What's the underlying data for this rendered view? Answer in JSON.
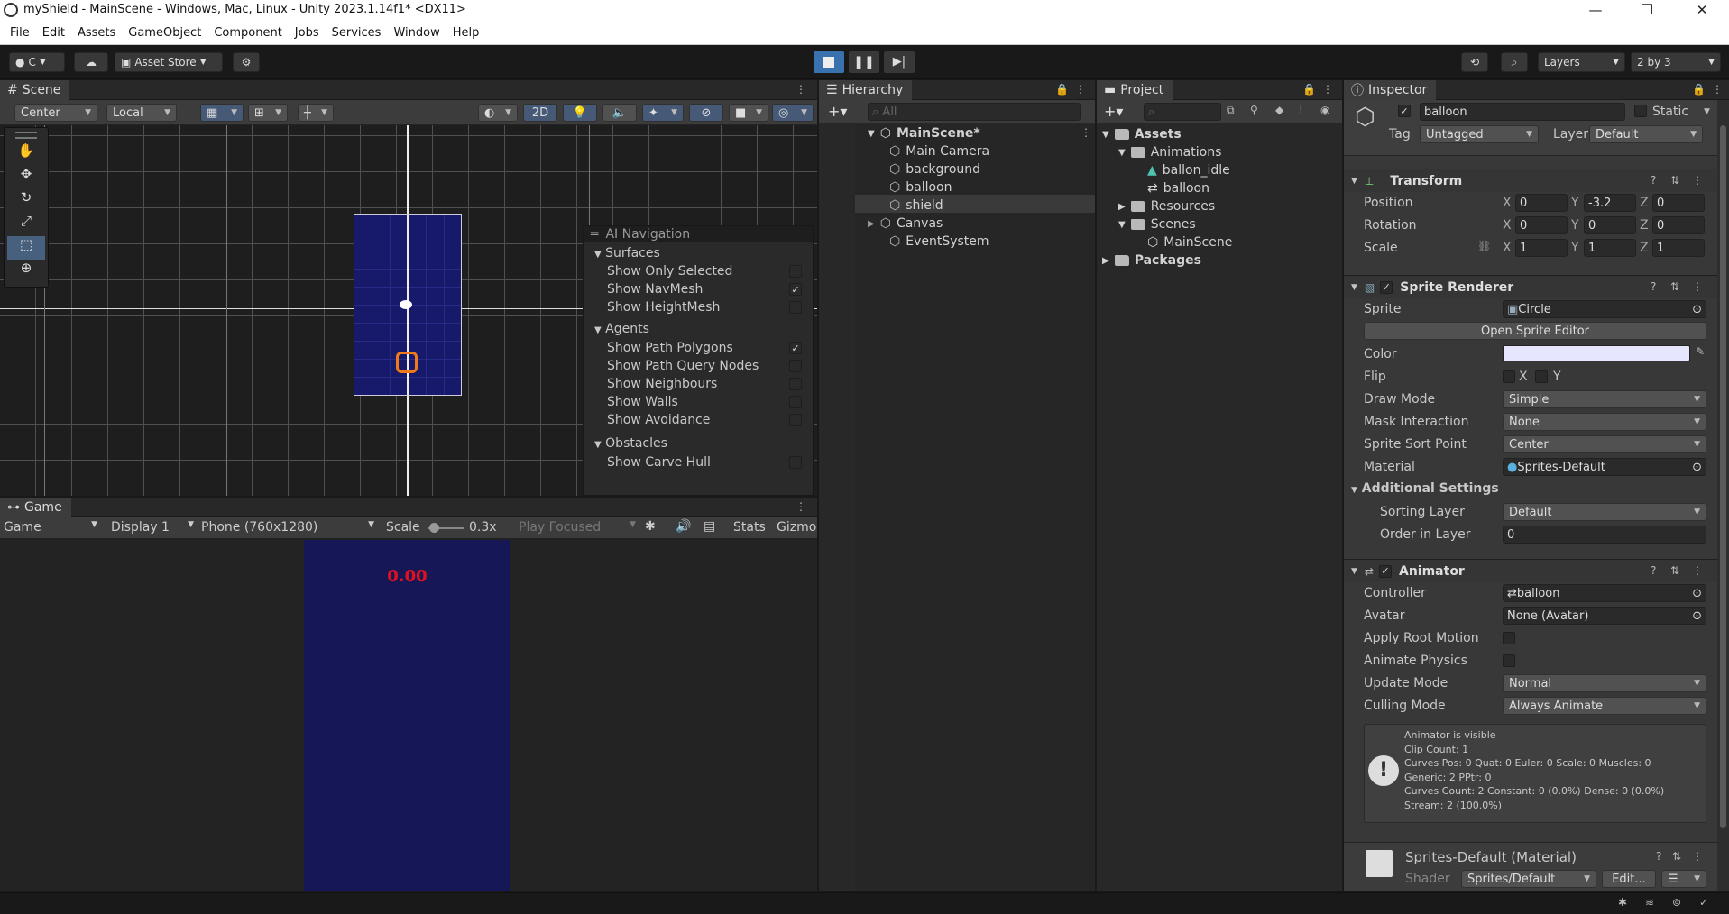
{
  "window": {
    "title": "myShield - MainScene - Windows, Mac, Linux - Unity 2023.1.14f1* <DX11>",
    "min": "—",
    "max": "❐",
    "close": "✕"
  },
  "menu": [
    "File",
    "Edit",
    "Assets",
    "GameObject",
    "Component",
    "Jobs",
    "Services",
    "Window",
    "Help"
  ],
  "toolbar": {
    "account": "C",
    "asset_store": "Asset Store",
    "layers": "Layers",
    "layout": "2 by 3"
  },
  "scene": {
    "tab": "Scene",
    "pivot": "Center",
    "space": "Local",
    "mode2d": "2D"
  },
  "ai_nav": {
    "title": "AI Navigation",
    "sections": [
      {
        "name": "Surfaces",
        "items": [
          {
            "label": "Show Only Selected",
            "checked": false
          },
          {
            "label": "Show NavMesh",
            "checked": true
          },
          {
            "label": "Show HeightMesh",
            "checked": false
          }
        ]
      },
      {
        "name": "Agents",
        "items": [
          {
            "label": "Show Path Polygons",
            "checked": true
          },
          {
            "label": "Show Path Query Nodes",
            "checked": false
          },
          {
            "label": "Show Neighbours",
            "checked": false
          },
          {
            "label": "Show Walls",
            "checked": false
          },
          {
            "label": "Show Avoidance",
            "checked": false
          }
        ]
      },
      {
        "name": "Obstacles",
        "items": [
          {
            "label": "Show Carve Hull",
            "checked": false
          }
        ]
      }
    ]
  },
  "game": {
    "tab": "Game",
    "view": "Game",
    "display": "Display 1",
    "resolution": "Phone (760x1280)",
    "scale_label": "Scale",
    "scale_value": "0.3x",
    "play_focused": "Play Focused",
    "stats": "Stats",
    "gizmos": "Gizmo",
    "score": "0.00"
  },
  "hierarchy": {
    "tab": "Hierarchy",
    "search": "All",
    "scene": "MainScene*",
    "items": [
      "Main Camera",
      "background",
      "balloon",
      "shield",
      "Canvas",
      "EventSystem"
    ]
  },
  "project": {
    "tab": "Project",
    "assets": "Assets",
    "animations": "Animations",
    "anim_items": [
      "ballon_idle",
      "balloon"
    ],
    "resources": "Resources",
    "scenes": "Scenes",
    "scene_item": "MainScene",
    "packages": "Packages"
  },
  "inspector": {
    "tab": "Inspector",
    "name": "balloon",
    "static": "Static",
    "tag_label": "Tag",
    "tag": "Untagged",
    "layer_label": "Layer",
    "layer": "Default",
    "transform": {
      "title": "Transform",
      "position": "Position",
      "rotation": "Rotation",
      "scale": "Scale",
      "px": "0",
      "py": "-3.2",
      "pz": "0",
      "rx": "0",
      "ry": "0",
      "rz": "0",
      "sx": "1",
      "sy": "1",
      "sz": "1",
      "x": "X",
      "y": "Y",
      "z": "Z"
    },
    "sprite_renderer": {
      "title": "Sprite Renderer",
      "sprite_label": "Sprite",
      "sprite": "Circle",
      "open_editor": "Open Sprite Editor",
      "color_label": "Color",
      "color": "#e6e6ff",
      "flip_label": "Flip",
      "flip_x": "X",
      "flip_y": "Y",
      "draw_mode_label": "Draw Mode",
      "draw_mode": "Simple",
      "mask_label": "Mask Interaction",
      "mask": "None",
      "sort_point_label": "Sprite Sort Point",
      "sort_point": "Center",
      "material_label": "Material",
      "material": "Sprites-Default",
      "additional": "Additional Settings",
      "sorting_layer_label": "Sorting Layer",
      "sorting_layer": "Default",
      "order_label": "Order in Layer",
      "order": "0"
    },
    "animator": {
      "title": "Animator",
      "controller_label": "Controller",
      "controller": "balloon",
      "avatar_label": "Avatar",
      "avatar": "None (Avatar)",
      "root_motion": "Apply Root Motion",
      "animate_physics": "Animate Physics",
      "update_label": "Update Mode",
      "update": "Normal",
      "culling_label": "Culling Mode",
      "culling": "Always Animate",
      "info": [
        "Animator is visible",
        "Clip Count: 1",
        "Curves Pos: 0 Quat: 0 Euler: 0 Scale: 0 Muscles: 0",
        "Generic: 2 PPtr: 0",
        "Curves Count: 2 Constant: 0 (0.0%) Dense: 0 (0.0%)",
        "Stream: 2 (100.0%)"
      ]
    },
    "material": {
      "title": "Sprites-Default (Material)",
      "shader_label": "Shader",
      "shader": "Sprites/Default",
      "edit": "Edit..."
    }
  }
}
